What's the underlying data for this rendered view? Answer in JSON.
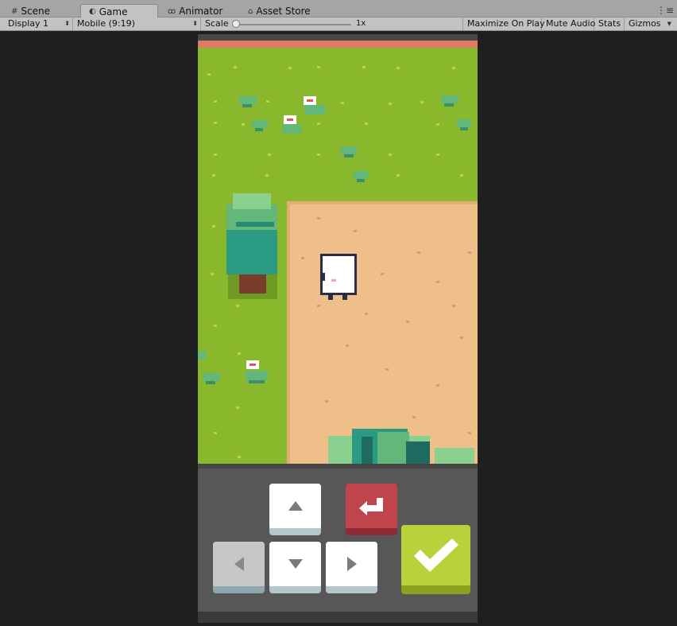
{
  "tabs": [
    {
      "icon": "grid-icon",
      "label": "Scene"
    },
    {
      "icon": "gamepad-icon",
      "label": "Game",
      "active": true
    },
    {
      "icon": "animator-icon",
      "label": "Animator"
    },
    {
      "icon": "store-icon",
      "label": "Asset Store"
    }
  ],
  "toolbar": {
    "display": "Display 1",
    "aspect": "Mobile (9:19)",
    "scale_label": "Scale",
    "scale_value": "1x",
    "maximize": "Maximize On Play",
    "mute": "Mute Audio",
    "stats": "Stats",
    "gizmos": "Gizmos"
  },
  "game": {
    "character": "ghost",
    "controls": {
      "up": "arrow-up-icon",
      "down": "arrow-down-icon",
      "left": "arrow-left-icon",
      "right": "arrow-right-icon",
      "back": "return-icon",
      "confirm": "check-icon"
    },
    "colors": {
      "grass": "#8ab82d",
      "sand": "#efbf8a",
      "tree": "#2a9b82",
      "button_red": "#c0444c",
      "button_green": "#b9d23c"
    }
  }
}
